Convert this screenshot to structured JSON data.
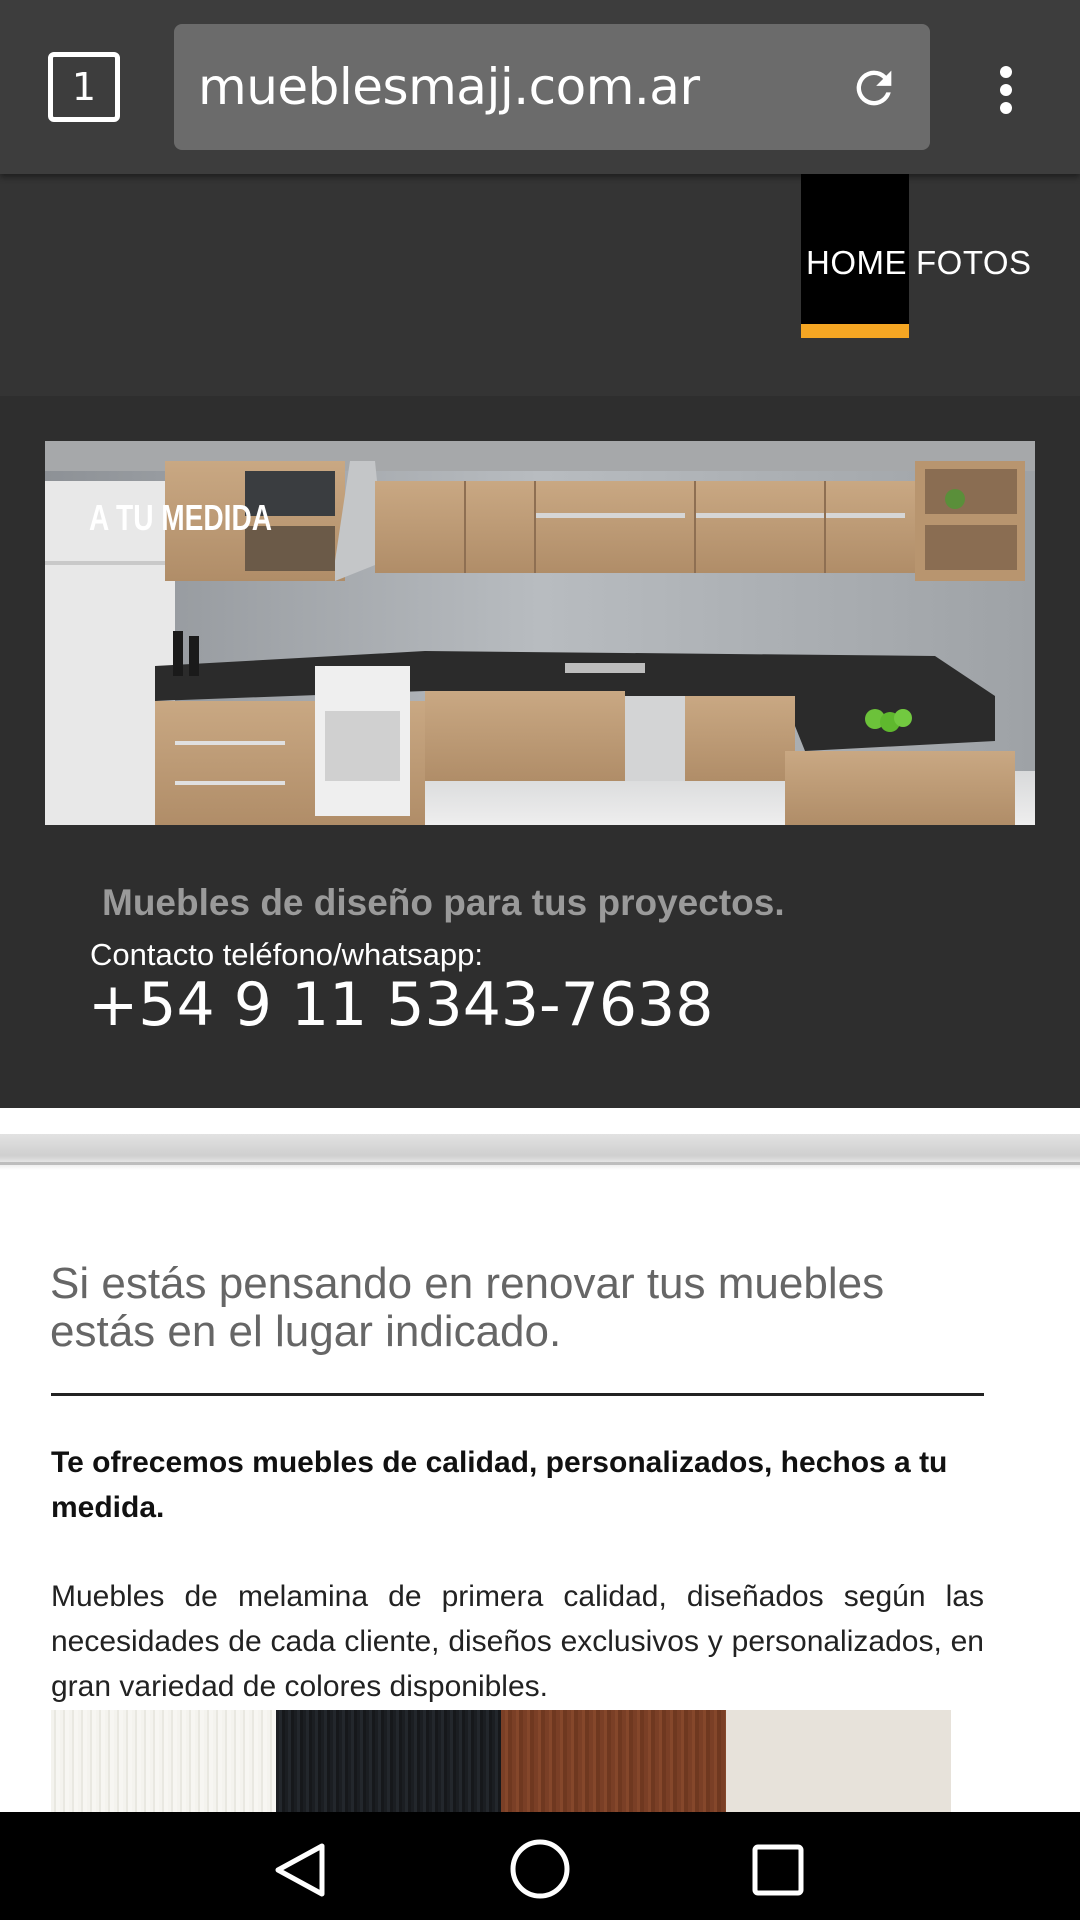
{
  "browser": {
    "tab_count": "1",
    "url": "mueblesmajj.com.ar"
  },
  "nav": {
    "items": [
      {
        "label": "HOME",
        "active": true
      },
      {
        "label": "FOTOS",
        "active": false
      }
    ],
    "accent_color": "#f5a623"
  },
  "hero": {
    "banner_title": "A TU MEDIDA",
    "tagline": "Muebles de diseño para tus proyectos.",
    "contact_label": "Contacto teléfono/whatsapp:",
    "phone": "+54 9 11 5343-7638"
  },
  "content": {
    "intro": "Si estás pensando en renovar tus muebles estás en el lugar indicado.",
    "offer": "Te ofrecemos muebles de calidad, personalizados, hechos a tu medida.",
    "description": "Muebles de melamina de primera calidad, diseñados según las necesidades de cada cliente, diseños exclusivos y personalizados, en gran variedad de colores disponibles.",
    "swatches": [
      "#f3f2ec",
      "#1a1d21",
      "#7a3f26",
      "#e7e2da"
    ]
  },
  "icons": {
    "reload": "reload-icon",
    "menu": "overflow-menu-icon",
    "back": "back-icon",
    "home": "home-icon",
    "recents": "recents-icon"
  }
}
